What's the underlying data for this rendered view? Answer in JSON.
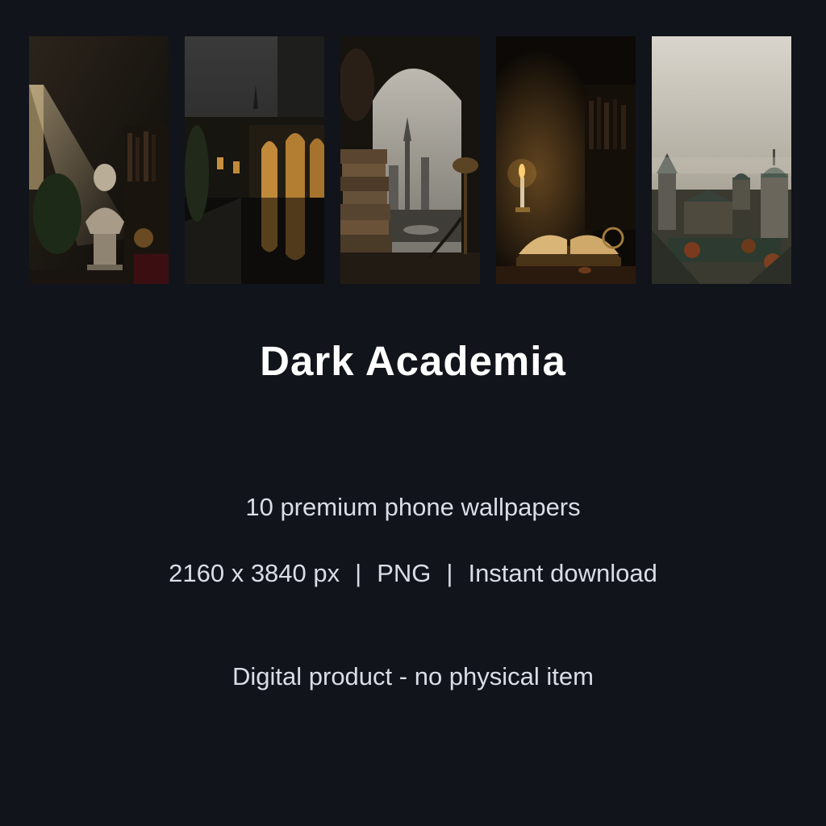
{
  "thumbnails": [
    {
      "icon": "classical-bust-library-image"
    },
    {
      "icon": "gothic-courtyard-reflection-image"
    },
    {
      "icon": "arched-window-books-image"
    },
    {
      "icon": "candlelit-open-book-image"
    },
    {
      "icon": "misty-city-rooftops-image"
    }
  ],
  "title": "Dark Academia",
  "subtitle": "10 premium phone wallpapers",
  "specs": {
    "resolution": "2160 x 3840 px",
    "separator": "|",
    "format": "PNG",
    "delivery": "Instant download"
  },
  "note": "Digital product - no physical item",
  "colors": {
    "background": "#12141b",
    "title": "#ffffff",
    "body_text": "#d8dde6"
  }
}
